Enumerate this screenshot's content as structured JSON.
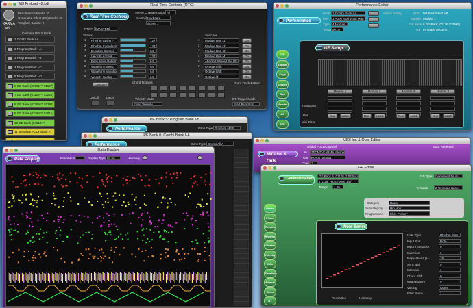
{
  "karma_window": {
    "title": "M3 Preload v2.kdf",
    "info": [
      "Performance Banks : 6",
      "Generated Effect (GE) Banks : 5",
      "Template Banks : 2"
    ],
    "brand": "KARMA",
    "m3": "M3",
    "contains_label": "Contains POLY Bank",
    "slots": [
      "1 Combi Bank I-A",
      "2 Program Bank I-A",
      "3 Program Bank I-B",
      "4 Program Bank I-C",
      "5 Program Bank I-D",
      "6 GE Bank (00001 ** 01127)",
      "7 GE Bank (01128 ** 02254)",
      "8 GE Bank (02256 ** 03383)",
      "9 GE Bank (03384 ** 04511)",
      "10 GE Bank (04512 ** 05639)",
      "11 Template POLY Bank A",
      "12 Template POLY Bank B"
    ],
    "highlight_colors": [
      "#3aa",
      "#3aa",
      "#3aa",
      "#3aa",
      "#3aa",
      "#7c4",
      "#7c4",
      "#7c4",
      "#7c4",
      "#7c4",
      "#dc3",
      "#dc3"
    ]
  },
  "rtc_window": {
    "title": "Real-Time Controls (RTC)",
    "heading": "Real-Time Controls",
    "scene_label": "Scene Change Options",
    "scene_value": "All",
    "control_label": "Control",
    "control_value": "Keyboard",
    "scene": "Scene 1",
    "rtc": "RTC#",
    "rtc_value": "[MASTER]",
    "sliders_label": "Sliders",
    "switches_label": "Switches",
    "sliders": [
      {
        "n": "1",
        "name": "Rhythm Swing F",
        "v": "127"
      },
      {
        "n": "2",
        "name": "Rhythm Complexity",
        "v": "127"
      },
      {
        "n": "3",
        "name": "Duration Control",
        "v": "64"
      },
      {
        "n": "4",
        "name": "Velocity Accent",
        "v": "127"
      },
      {
        "n": "5",
        "name": "Percussive Pattern",
        "v": "64"
      },
      {
        "n": "6",
        "name": "Waveform Select",
        "v": "64"
      },
      {
        "n": "7",
        "name": "Waveform Variation",
        "v": "64"
      },
      {
        "n": "8",
        "name": "Velocity Control",
        "v": "64"
      }
    ],
    "switches": [
      {
        "n": "1",
        "name": "Module Run (1)",
        "v": "On"
      },
      {
        "n": "2",
        "name": "Module Run (2)",
        "v": "On"
      },
      {
        "n": "3",
        "name": "Module Run (3)",
        "v": "On"
      },
      {
        "n": "4",
        "name": "Module Run (4)",
        "v": "On"
      },
      {
        "n": "5",
        "name": "Affected Shared Sw (SUSP)",
        "v": "On"
      },
      {
        "n": "6",
        "name": "Octave Shift",
        "v": "On"
      },
      {
        "n": "7",
        "name": "Octave Shift",
        "v": "On"
      },
      {
        "n": "8",
        "name": "Octave (4)",
        "v": "On"
      }
    ],
    "compare": "Compare",
    "on_off": "On/Off",
    "latch": "Latch",
    "chord_triggers": "Chord Triggers",
    "drum_track": "Drum Track Pattern",
    "velocity_mode": "Velocity Mode",
    "velocity_value": "Fixed Velocity",
    "dt_trigger": "DT Trigger Mode",
    "dt_value": "Start Run Stop"
  },
  "perf_window": {
    "title": "Performance Editor",
    "heading": "Performance",
    "bank": "Bank",
    "bank_value": "1 Combi Bank I-A",
    "perf": "Perf",
    "perf_value": "1 A000 Mod Wind Map",
    "type": "Type",
    "type_value": "4 Module",
    "tempo": "Tempo",
    "tempo_value": "90.00",
    "status": "Status Editing",
    "kdf": "KDF",
    "kdf_value": "M3 Preload v2.kdf",
    "module": "Module",
    "module_value": "Module 1",
    "ge_bank": "GE Bank",
    "ge_value": "6 GE Bank (01128 ** 0995)",
    "ge": "GE",
    "ge_name": "07 Rapid Accomp",
    "tabs": [
      "GE Setup",
      "Trigger",
      "Keys",
      "Scenes",
      "Dyn Midi",
      "Sends",
      "CC Offsets",
      "RTC"
    ],
    "ge_setup": "GE Setup",
    "modules": [
      "Module 1",
      "Module 2",
      "Module 3",
      "Module 4"
    ],
    "transpose": "Transpose",
    "run_labels": [
      "Run",
      "Latch"
    ],
    "midi_filter": "Midi Filter"
  },
  "perfbank2": {
    "title": "PE Bank 5: Program Bank I-B",
    "heading": "Performance Bank",
    "bank_type": "Bank Type",
    "bank_type_value": "Program M3 B"
  },
  "perfbank1": {
    "title": "PE Bank 0: Combi Bank I-A",
    "heading": "Performance Bank",
    "bank_type": "Bank Type",
    "bank_type_value": "Combi All A"
  },
  "midi_window": {
    "title": "MIDI Ins & Outs Editor",
    "heading": "MIDI Ins & Outs",
    "port_label": "Global Port1/Channel",
    "in_label": "In",
    "in_value": "3ECMD-KARMA Internal",
    "out_label": "Out",
    "out_value": "KORG M3 Int1",
    "chan_label": "Chan",
    "chan_value": "1",
    "rec_label": "MIDI Received"
  },
  "ge_editor": {
    "title": "GE Editor",
    "heading": "Generated Effect",
    "bank": "GE Bank 6 (01128 ** 02254)",
    "ge": "1 1128: Hip Groove 1(D)",
    "tempo": "Tempo",
    "tempo_value": "1.40",
    "category": "Category",
    "category_value": "Drum",
    "subcategory": "Subcategory",
    "subcategory_value": "Hip Hop",
    "programmer": "Programmer",
    "programmer_value": "Elvis Presley",
    "note_series": "Note Series",
    "tabs": [
      "Series",
      "Phase",
      "Direction",
      "Rhythm",
      "Cluster",
      "Velocity",
      "CCs",
      "Envelope",
      "Repeat",
      "Drum",
      "RT Params"
    ],
    "params": [
      {
        "k": "Note Type",
        "v": "Rhythm Stim"
      },
      {
        "k": "Input Sort",
        "v": "Note"
      },
      {
        "k": "Input Transpose",
        "v": "0"
      },
      {
        "k": "Inversion",
        "v": "0"
      },
      {
        "k": "Replications (+/-)",
        "v": "16"
      },
      {
        "k": "Sync with",
        "v": "0"
      },
      {
        "k": "Intervals",
        "v": "1"
      },
      {
        "k": "Chord Shift",
        "v": "0"
      },
      {
        "k": "Wrap Bottom",
        "v": "0"
      },
      {
        "k": "Voicing",
        "v": "Open"
      },
      {
        "k": "Filter Steps",
        "v": "1"
      }
    ],
    "resolution": "Resolution",
    "harmony": "Harmony",
    "ge_type": "GE Type",
    "ge_type_value": "Generated Drum",
    "template": "Template",
    "template_value": "2 Template Bank"
  },
  "data_window": {
    "title": "Data Display",
    "heading": "Data Display",
    "resolution": "Resolution",
    "display_type": "Display Type",
    "display_value": "Bit up",
    "harmony": "Harmony"
  },
  "colors": {
    "accent": "#2fb8c9",
    "green": "#3f9c5a",
    "purple": "#8a3fb0"
  }
}
